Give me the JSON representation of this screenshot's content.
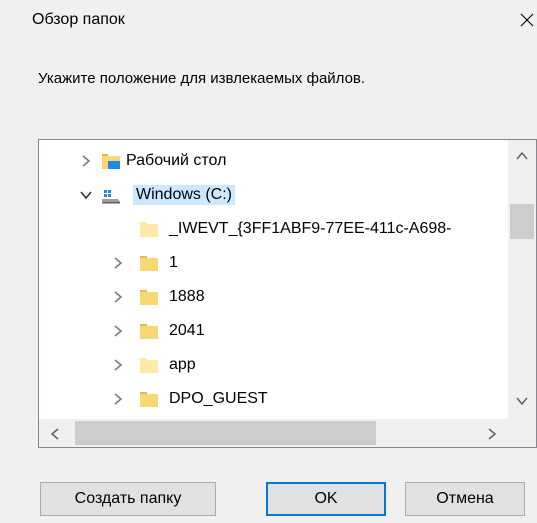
{
  "window": {
    "title": "Обзор папок"
  },
  "instruction": "Укажите положение для извлекаемых файлов.",
  "tree": {
    "items": [
      {
        "label": "Рабочий стол",
        "expanded": false,
        "icon": "desktop-folder-icon"
      },
      {
        "label": "Windows (C:)",
        "expanded": true,
        "selected": true,
        "icon": "windows-drive-icon"
      },
      {
        "label": "_IWEVT_{3FF1ABF9-77EE-411c-A698-",
        "expandable": false,
        "icon": "folder-icon"
      },
      {
        "label": "1",
        "expandable": true,
        "icon": "folder-icon"
      },
      {
        "label": "1888",
        "expandable": true,
        "icon": "folder-icon"
      },
      {
        "label": "2041",
        "expandable": true,
        "icon": "folder-icon"
      },
      {
        "label": "app",
        "expandable": true,
        "icon": "folder-icon"
      },
      {
        "label": "DPO_GUEST",
        "expandable": true,
        "icon": "folder-icon"
      }
    ]
  },
  "buttons": {
    "new_folder": "Создать папку",
    "ok": "OK",
    "cancel": "Отмена"
  },
  "colors": {
    "selection": "#cce8ff",
    "folder_yellow": "#f8d775",
    "desktop_blue": "#1e88e5",
    "default_button_border": "#0078d7"
  }
}
